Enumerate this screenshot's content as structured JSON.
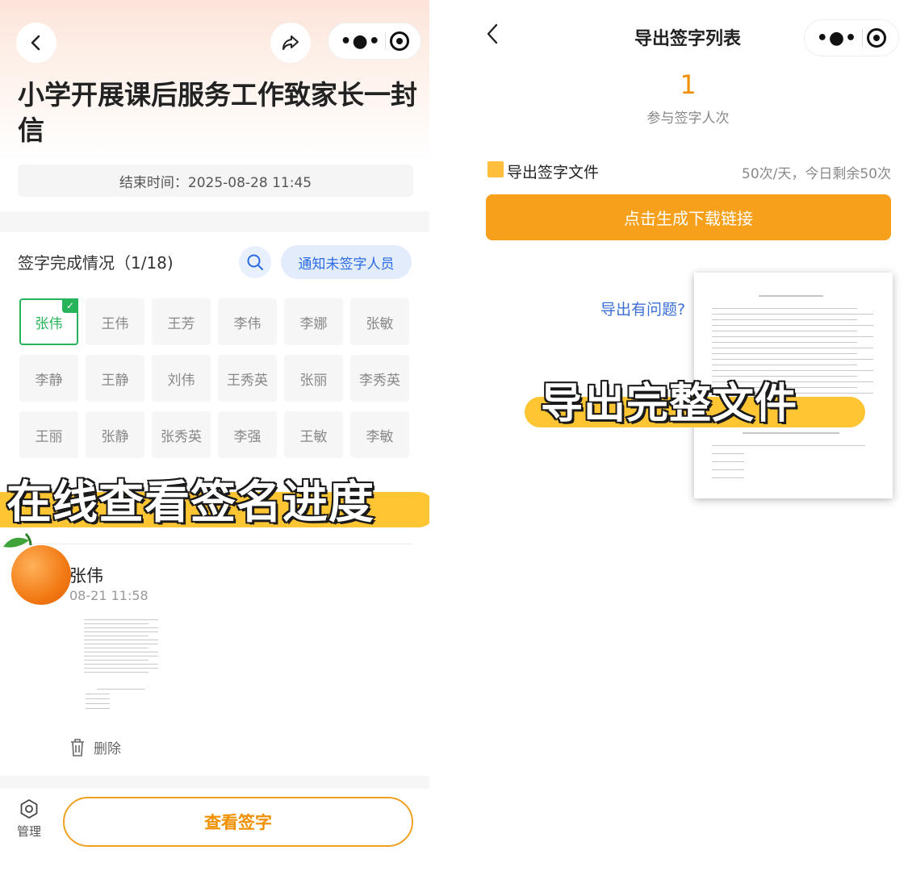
{
  "left": {
    "title": "小学开展课后服务工作致家长一封信",
    "end_time": "结束时间：2025-08-28 11:45",
    "progress_label": "签字完成情况（1/18)",
    "notify_button": "通知未签字人员",
    "names": [
      {
        "name": "张伟",
        "signed": true
      },
      {
        "name": "王伟",
        "signed": false
      },
      {
        "name": "王芳",
        "signed": false
      },
      {
        "name": "李伟",
        "signed": false
      },
      {
        "name": "李娜",
        "signed": false
      },
      {
        "name": "张敏",
        "signed": false
      },
      {
        "name": "李静",
        "signed": false
      },
      {
        "name": "王静",
        "signed": false
      },
      {
        "name": "刘伟",
        "signed": false
      },
      {
        "name": "王秀英",
        "signed": false
      },
      {
        "name": "张丽",
        "signed": false
      },
      {
        "name": "李秀英",
        "signed": false
      },
      {
        "name": "王丽",
        "signed": false
      },
      {
        "name": "张静",
        "signed": false
      },
      {
        "name": "张秀英",
        "signed": false
      },
      {
        "name": "李强",
        "signed": false
      },
      {
        "name": "王敏",
        "signed": false
      },
      {
        "name": "李敏",
        "signed": false
      }
    ],
    "banner": "在线查看签名进度",
    "signer": {
      "name": "张伟",
      "time": "08-21 11:58"
    },
    "delete_label": "删除",
    "manage_label": "管理",
    "view_button": "查看签字"
  },
  "right": {
    "title": "导出签字列表",
    "count": "1",
    "count_label": "参与签字人次",
    "export_label": "导出签字文件",
    "quota": "50次/天，今日剩余50次",
    "generate_button": "点击生成下载链接",
    "help_link": "导出有问题?",
    "banner": "导出完整文件"
  },
  "colors": {
    "accent_orange": "#f7a01b",
    "signed_green": "#26b35a",
    "link_blue": "#3b6fd6",
    "banner_yellow": "#ffc533"
  },
  "icons": [
    "back-icon",
    "share-icon",
    "more-icon",
    "target-icon",
    "search-icon",
    "trash-icon",
    "settings-icon",
    "folder-icon",
    "check-icon"
  ]
}
